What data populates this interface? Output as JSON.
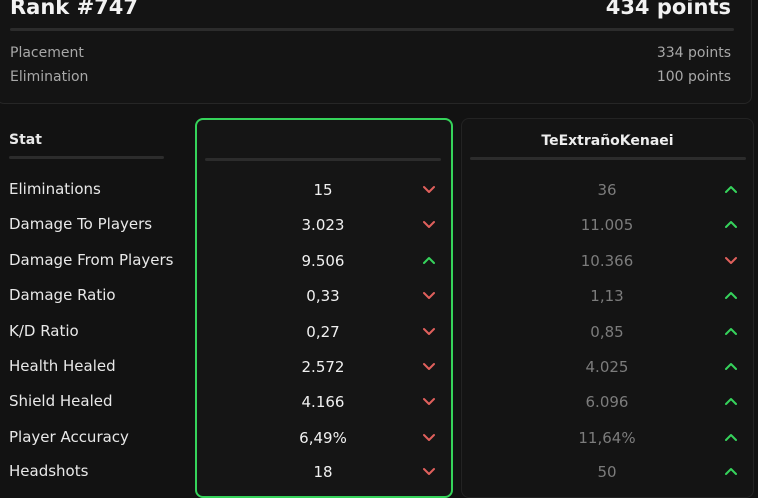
{
  "rank": {
    "title": "Rank #747",
    "points": "434 points",
    "rows": [
      {
        "label": "Placement",
        "value": "334 points"
      },
      {
        "label": "Elimination",
        "value": "100 points"
      }
    ]
  },
  "stats": {
    "header": "Stat",
    "player_name": "",
    "opponent_name": "TeExtrañoKenaei",
    "colors": {
      "up": "#36d35c",
      "down": "#e0605c",
      "player_border": "#35d35a"
    },
    "rows": [
      {
        "name": "Eliminations",
        "player": "15",
        "player_dir": "down",
        "opponent": "36",
        "opponent_dir": "up"
      },
      {
        "name": "Damage To Players",
        "player": "3.023",
        "player_dir": "down",
        "opponent": "11.005",
        "opponent_dir": "up"
      },
      {
        "name": "Damage From Players",
        "player": "9.506",
        "player_dir": "up",
        "opponent": "10.366",
        "opponent_dir": "down"
      },
      {
        "name": "Damage Ratio",
        "player": "0,33",
        "player_dir": "down",
        "opponent": "1,13",
        "opponent_dir": "up"
      },
      {
        "name": "K/D Ratio",
        "player": "0,27",
        "player_dir": "down",
        "opponent": "0,85",
        "opponent_dir": "up"
      },
      {
        "name": "Health Healed",
        "player": "2.572",
        "player_dir": "down",
        "opponent": "4.025",
        "opponent_dir": "up"
      },
      {
        "name": "Shield Healed",
        "player": "4.166",
        "player_dir": "down",
        "opponent": "6.096",
        "opponent_dir": "up"
      },
      {
        "name": "Player Accuracy",
        "player": "6,49%",
        "player_dir": "down",
        "opponent": "11,64%",
        "opponent_dir": "up"
      },
      {
        "name": "Headshots",
        "player": "18",
        "player_dir": "down",
        "opponent": "50",
        "opponent_dir": "up"
      }
    ]
  }
}
